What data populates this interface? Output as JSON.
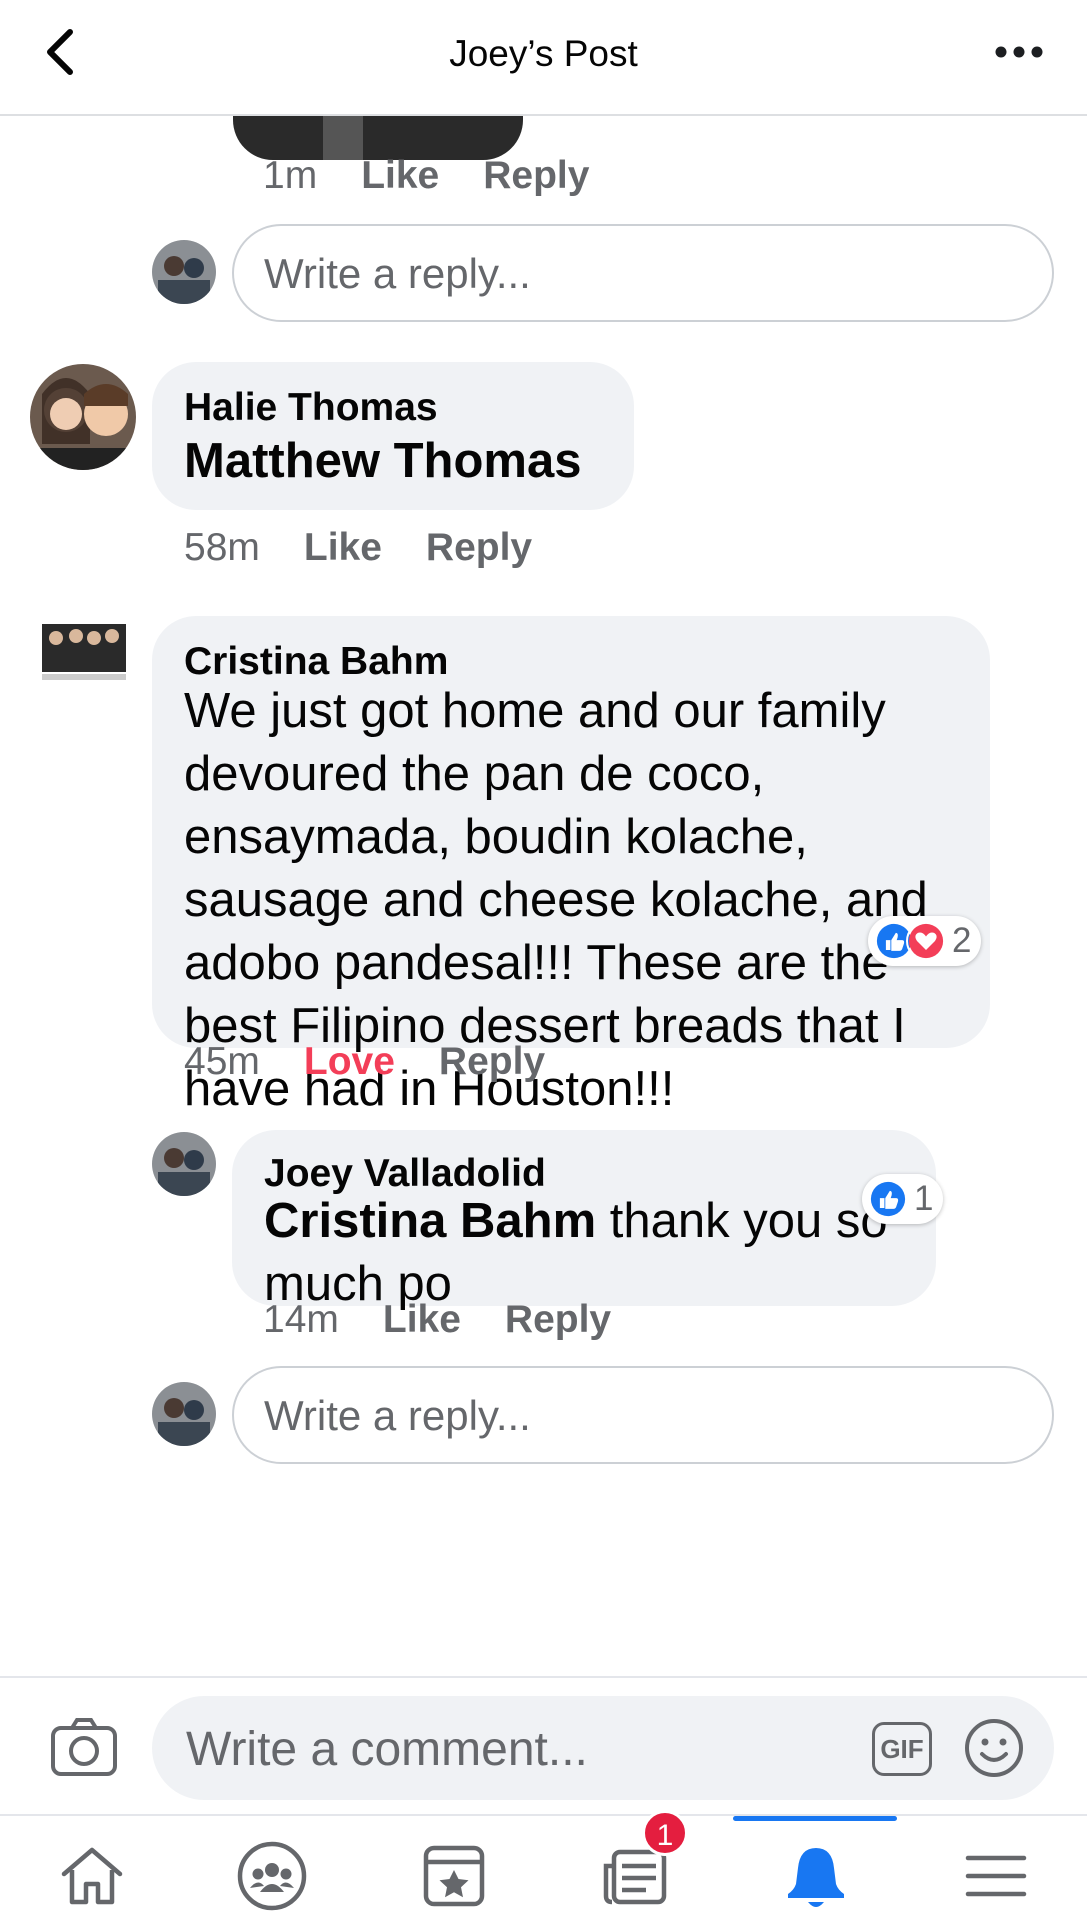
{
  "header": {
    "title": "Joey’s Post"
  },
  "first_reply_meta": {
    "time": "1m",
    "like": "Like",
    "reply": "Reply"
  },
  "reply_input_placeholder": "Write a reply...",
  "comments": [
    {
      "author": "Halie Thomas",
      "mention": "Matthew Thomas",
      "text": "",
      "time": "58m",
      "reaction_label": "Like",
      "reply_label": "Reply"
    },
    {
      "author": "Cristina Bahm",
      "text": "We just got home and our family devoured the pan de coco, ensaymada, boudin kolache, sausage and cheese kolache, and adobo pandesal!!! These are the best Filipino dessert breads that I have had in Houston!!!",
      "time": "45m",
      "reaction_label": "Love",
      "reply_label": "Reply",
      "reaction_count": "2",
      "reaction_icons": [
        "like-icon",
        "love-icon"
      ]
    }
  ],
  "nested_reply": {
    "author": "Joey Valladolid",
    "mention": "Cristina Bahm",
    "text": " thank you so much po",
    "time": "14m",
    "reaction_label": "Like",
    "reply_label": "Reply",
    "reaction_count": "1",
    "reaction_icons": [
      "like-icon"
    ]
  },
  "composer": {
    "placeholder": "Write a comment...",
    "gif_label": "GIF"
  },
  "bottom_nav": {
    "items": [
      "home-icon",
      "groups-icon",
      "pages-icon",
      "news-icon",
      "notifications-icon",
      "menu-icon"
    ],
    "active": "notifications-icon",
    "news_badge": "1"
  },
  "colors": {
    "accent": "#1877f2",
    "love": "#f33e58",
    "badge": "#e41e3f",
    "bubble": "#f0f2f5",
    "meta": "#65676b"
  }
}
